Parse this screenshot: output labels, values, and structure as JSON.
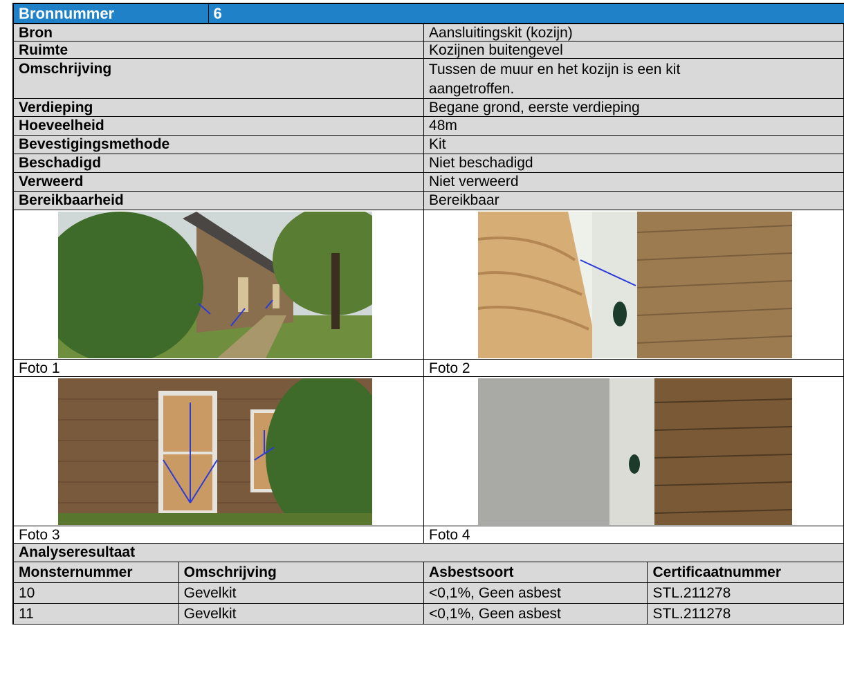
{
  "header": {
    "label": "Bronnummer",
    "value": "6"
  },
  "rows": [
    {
      "label": "Bron",
      "value": "Aansluitingskit (kozijn)"
    },
    {
      "label": "Ruimte",
      "value": "Kozijnen buitengevel"
    },
    {
      "label": "Omschrijving",
      "value": "Tussen de muur en het kozijn is een kit aangetroffen."
    },
    {
      "label": "Verdieping",
      "value": "Begane grond, eerste verdieping"
    },
    {
      "label": "Hoeveelheid",
      "value": "48m"
    },
    {
      "label": "Bevestigingsmethode",
      "value": "Kit"
    },
    {
      "label": "Beschadigd",
      "value": "Niet beschadigd"
    },
    {
      "label": "Verweerd",
      "value": "Niet verweerd"
    },
    {
      "label": "Bereikbaarheid",
      "value": "Bereikbaar"
    }
  ],
  "photos": [
    {
      "caption": "Foto 1",
      "subject": "farmhouse-exterior-photo"
    },
    {
      "caption": "Foto 2",
      "subject": "window-frame-sealant-closeup-photo"
    },
    {
      "caption": "Foto 3",
      "subject": "boarded-window-facade-photo"
    },
    {
      "caption": "Foto 4",
      "subject": "window-frame-brick-closeup-photo"
    }
  ],
  "analysis": {
    "title": "Analyseresultaat",
    "columns": [
      "Monsternummer",
      "Omschrijving",
      "Asbestsoort",
      "Certificaatnummer"
    ],
    "rows": [
      [
        "10",
        "Gevelkit",
        "<0,1%, Geen asbest",
        "STL.211278"
      ],
      [
        "11",
        "Gevelkit",
        "<0,1%, Geen asbest",
        "STL.211278"
      ]
    ]
  },
  "colors": {
    "header_bg": "#1f82c8",
    "cell_bg": "#d9d9d9",
    "arrow": "#2b3bd8"
  }
}
